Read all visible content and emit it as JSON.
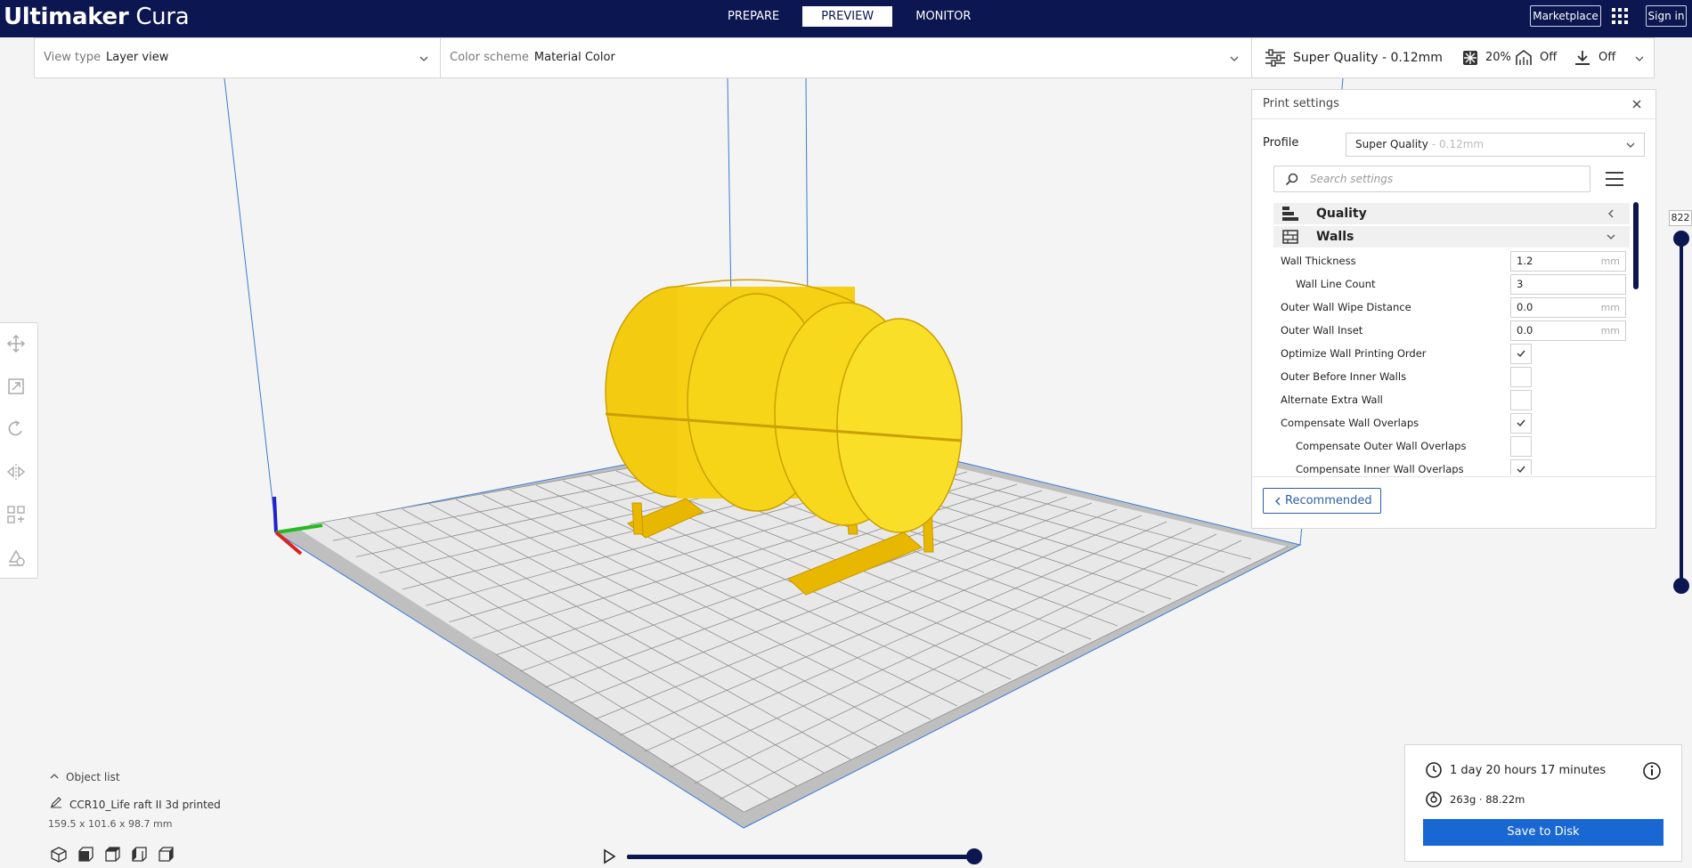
{
  "app": {
    "brand_bold": "Ultimaker",
    "brand_light": " Cura"
  },
  "stages": [
    {
      "label": "PREPARE",
      "active": false
    },
    {
      "label": "PREVIEW",
      "active": true
    },
    {
      "label": "MONITOR",
      "active": false
    }
  ],
  "topbar": {
    "marketplace_label": "Marketplace",
    "signin_label": "Sign in"
  },
  "viewbar": {
    "view_type_label": "View type",
    "view_type_value": "Layer view",
    "color_scheme_label": "Color scheme",
    "color_scheme_value": "Material Color"
  },
  "print_summary": {
    "profile": "Super Quality - 0.12mm",
    "infill": "20%",
    "support": "Off",
    "adhesion": "Off"
  },
  "settings_panel": {
    "title": "Print settings",
    "profile_label": "Profile",
    "profile_value": "Super Quality",
    "profile_sub": "- 0.12mm",
    "search_placeholder": "Search settings",
    "categories": [
      {
        "label": "Quality",
        "expanded": false
      },
      {
        "label": "Walls",
        "expanded": true
      }
    ],
    "settings": [
      {
        "label": "Wall Thickness",
        "type": "number",
        "value": "1.2",
        "unit": "mm",
        "child": false
      },
      {
        "label": "Wall Line Count",
        "type": "number",
        "value": "3",
        "unit": "",
        "child": true
      },
      {
        "label": "Outer Wall Wipe Distance",
        "type": "number",
        "value": "0.0",
        "unit": "mm",
        "child": false
      },
      {
        "label": "Outer Wall Inset",
        "type": "number",
        "value": "0.0",
        "unit": "mm",
        "child": false
      },
      {
        "label": "Optimize Wall Printing Order",
        "type": "check",
        "checked": true,
        "child": false
      },
      {
        "label": "Outer Before Inner Walls",
        "type": "check",
        "checked": false,
        "child": false
      },
      {
        "label": "Alternate Extra Wall",
        "type": "check",
        "checked": false,
        "child": false
      },
      {
        "label": "Compensate Wall Overlaps",
        "type": "check",
        "checked": true,
        "child": false
      },
      {
        "label": "Compensate Outer Wall Overlaps",
        "type": "check",
        "checked": false,
        "child": true
      },
      {
        "label": "Compensate Inner Wall Overlaps",
        "type": "check",
        "checked": true,
        "child": true
      }
    ],
    "recommended_label": "Recommended"
  },
  "layer_slider": {
    "value": "822"
  },
  "object_list": {
    "toggle_label": "Object list",
    "object_name": "CCR10_Life raft II 3d printed",
    "dimensions": "159.5 x 101.6 x 98.7 mm"
  },
  "estimate": {
    "time": "1 day 20 hours 17 minutes",
    "material": "263g · 88.22m",
    "save_label": "Save to Disk"
  },
  "colors": {
    "brand_navy": "#0c1650",
    "accent_blue": "#1967d2",
    "model_yellow": "#f7d31a"
  }
}
